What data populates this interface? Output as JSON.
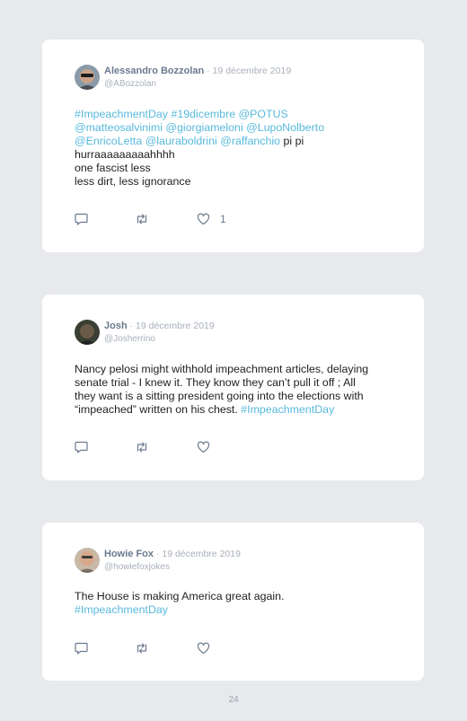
{
  "tweets": [
    {
      "author": "Alessandro Bozzolan",
      "separator": " · ",
      "date": "19 décembre 2019",
      "handle": "@ABozzolan",
      "lines": [
        [
          {
            "t": "#ImpeachmentDay",
            "link": true
          },
          {
            "t": " "
          },
          {
            "t": "#19dicembre",
            "link": true
          },
          {
            "t": " "
          },
          {
            "t": "@POTUS",
            "link": true
          }
        ],
        [
          {
            "t": "@matteosalvinimi",
            "link": true
          },
          {
            "t": " "
          },
          {
            "t": "@giorgiameloni",
            "link": true
          },
          {
            "t": " "
          },
          {
            "t": "@LupoNolberto",
            "link": true
          }
        ],
        [
          {
            "t": "@EnricoLetta",
            "link": true
          },
          {
            "t": " "
          },
          {
            "t": "@lauraboldrini",
            "link": true
          },
          {
            "t": " "
          },
          {
            "t": "@raffanchio",
            "link": true
          },
          {
            "t": " pi pi"
          }
        ],
        [
          {
            "t": "hurraaaaaaaaahhhh"
          }
        ],
        [
          {
            "t": "one fascist less"
          }
        ],
        [
          {
            "t": "less dirt, less ignorance"
          }
        ]
      ],
      "likes": "1",
      "avatar_bg": "#8a9aa8"
    },
    {
      "author": "Josh",
      "separator": " · ",
      "date": "19 décembre 2019",
      "handle": "@Josherrino",
      "lines": [
        [
          {
            "t": "Nancy pelosi might withhold impeachment articles, delaying"
          }
        ],
        [
          {
            "t": "senate trial - I knew it. They know they can’t pull it off ; All"
          }
        ],
        [
          {
            "t": "they want is a sitting president going into the elections with"
          }
        ],
        [
          {
            "t": "“impeached” written on his chest. "
          },
          {
            "t": "#ImpeachmentDay",
            "link": true
          }
        ]
      ],
      "likes": "",
      "avatar_bg": "#3a3f34"
    },
    {
      "author": "Howie Fox",
      "separator": " · ",
      "date": "19 décembre 2019",
      "handle": "@howiefoxjokes",
      "lines": [
        [
          {
            "t": "The House is making America great again."
          }
        ],
        [
          {
            "t": "#ImpeachmentDay",
            "link": true
          }
        ]
      ],
      "likes": "",
      "avatar_bg": "#c9b8a6"
    }
  ],
  "page_number": "24",
  "icons": {
    "reply": "reply-icon",
    "retweet": "retweet-icon",
    "like": "like-icon"
  },
  "colors": {
    "link": "#58b9dc",
    "author": "#6b7a8f",
    "muted": "#a9b0bc",
    "background": "#e8e9ed"
  }
}
